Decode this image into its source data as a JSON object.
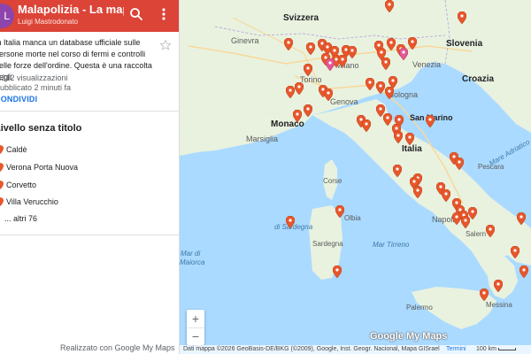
{
  "header": {
    "avatar_letter": "L",
    "title": "Malapolizia - La mappa",
    "author": "Luigi Mastrodonato"
  },
  "info": {
    "description": "In Italia manca un database ufficiale sulle persone morte nel corso di fermi e controlli delle forze dell'ordine. Questa è una raccolta degli",
    "views": "9.212 visualizzazioni",
    "updated": "Pubblicato 2 minuti fa",
    "share_label": "CONDIVIDI"
  },
  "layer": {
    "title": "Livello senza titolo",
    "items": [
      {
        "label": "Caldè"
      },
      {
        "label": "Verona Porta Nuova"
      },
      {
        "label": "Corvetto"
      },
      {
        "label": "Villa Verucchio"
      }
    ],
    "more_label": "... altri 76"
  },
  "footer": {
    "made_with": "Realizzato con Google My Maps"
  },
  "map": {
    "countries": {
      "switzerland": "Svizzera",
      "slovenia": "Slovenia",
      "croatia": "Croazia",
      "italy": "Italia",
      "monaco": "Monaco"
    },
    "places": {
      "geneva": "Ginevra",
      "milan": "Milano",
      "venice": "Venezia",
      "turin": "Torino",
      "genoa": "Genova",
      "bologna": "Bologna",
      "marseille": "Marsiglia",
      "san_marino": "San Marino",
      "corsica": "Corse",
      "pescara": "Pescara",
      "naples": "Napoli",
      "olbia": "Olbia",
      "sardinia": "Sardegna",
      "salerno": "Salern",
      "messina": "Messina",
      "palermo": "Palermo"
    },
    "seas": {
      "adriatic": "Mare Adriatico",
      "tyrrhenian": "Mar Tirreno",
      "di_sardegna": "di Sardegna",
      "balearic": "Mar di\nMaiorca",
      "balearic_line1": "Mar di",
      "balearic_line2": "Maiorca"
    },
    "logo": "Google My Maps",
    "attribution": "Dati mappa ©2026 GeoBasis-DE/BKG (©2009), Google, Inst. Geogr. Nacional, Mapa GISrael",
    "terms": "Termini",
    "scale": "100 km",
    "zoom_in": "+",
    "zoom_out": "−",
    "land_color": "#e9f2df",
    "water_color": "#aadaff",
    "marker_color": "#e8572c",
    "marker_selected_color": "#e3569a"
  }
}
